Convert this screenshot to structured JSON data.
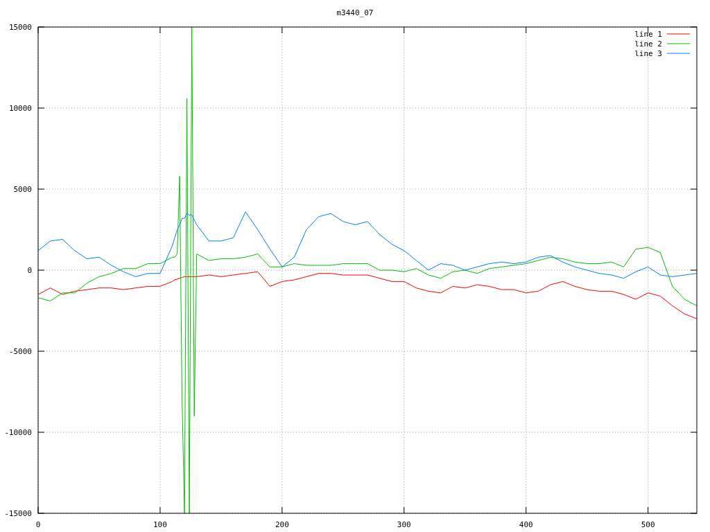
{
  "chart_data": {
    "type": "line",
    "title": "m3440_07",
    "grid": true,
    "legend": true,
    "xlim": [
      0,
      540
    ],
    "ylim": [
      -15000,
      15000
    ],
    "xticks": [
      0,
      100,
      200,
      300,
      400,
      500
    ],
    "yticks": [
      -15000,
      -10000,
      -5000,
      0,
      5000,
      10000,
      15000
    ],
    "x": [
      0,
      10,
      20,
      30,
      40,
      50,
      60,
      70,
      80,
      90,
      100,
      110,
      112,
      114,
      116,
      118,
      120,
      122,
      124,
      126,
      128,
      130,
      140,
      150,
      160,
      170,
      180,
      190,
      200,
      210,
      220,
      230,
      240,
      250,
      260,
      270,
      280,
      290,
      300,
      310,
      320,
      330,
      340,
      350,
      360,
      370,
      380,
      390,
      400,
      410,
      420,
      430,
      440,
      450,
      460,
      470,
      480,
      490,
      500,
      510,
      520,
      530,
      540
    ],
    "series": [
      {
        "name": "line 1",
        "color": "#ff0000",
        "values": [
          -1500,
          -1100,
          -1500,
          -1300,
          -1200,
          -1100,
          -1100,
          -1200,
          -1100,
          -1000,
          -1000,
          -700,
          -600,
          -550,
          -500,
          -450,
          -400,
          -400,
          -400,
          -400,
          -400,
          -400,
          -300,
          -400,
          -300,
          -200,
          -100,
          -1000,
          -700,
          -600,
          -400,
          -200,
          -200,
          -300,
          -300,
          -300,
          -500,
          -700,
          -700,
          -1100,
          -1300,
          -1400,
          -1000,
          -1100,
          -900,
          -1000,
          -1200,
          -1200,
          -1400,
          -1300,
          -900,
          -700,
          -1000,
          -1200,
          -1300,
          -1300,
          -1500,
          -1800,
          -1400,
          -1600,
          -2200,
          -2700,
          -3000
        ]
      },
      {
        "name": "line 2",
        "color": "#00c000",
        "values": [
          -1700,
          -1900,
          -1400,
          -1400,
          -800,
          -400,
          -200,
          100,
          100,
          400,
          400,
          800,
          800,
          1000,
          5800,
          -8000,
          -15000,
          10600,
          -15000,
          15000,
          -9000,
          1000,
          600,
          700,
          700,
          800,
          1000,
          200,
          200,
          400,
          300,
          300,
          300,
          400,
          400,
          400,
          0,
          0,
          -100,
          100,
          -300,
          -500,
          -100,
          0,
          -200,
          100,
          200,
          300,
          400,
          600,
          800,
          700,
          500,
          400,
          400,
          500,
          200,
          1300,
          1400,
          1100,
          -1000,
          -1800,
          -2200
        ]
      },
      {
        "name": "line 3",
        "color": "#0080ff",
        "values": [
          1200,
          1800,
          1900,
          1200,
          700,
          800,
          300,
          -100,
          -400,
          -200,
          -200,
          1500,
          2000,
          2500,
          2800,
          3200,
          3200,
          3500,
          3400,
          3400,
          3100,
          2800,
          1800,
          1800,
          2000,
          3600,
          2500,
          1300,
          200,
          800,
          2500,
          3300,
          3500,
          3000,
          2800,
          3000,
          2200,
          1600,
          1200,
          600,
          0,
          400,
          300,
          0,
          200,
          400,
          500,
          400,
          500,
          800,
          900,
          500,
          200,
          0,
          -200,
          -300,
          -500,
          -100,
          200,
          -300,
          -400,
          -300,
          -200
        ]
      }
    ]
  }
}
